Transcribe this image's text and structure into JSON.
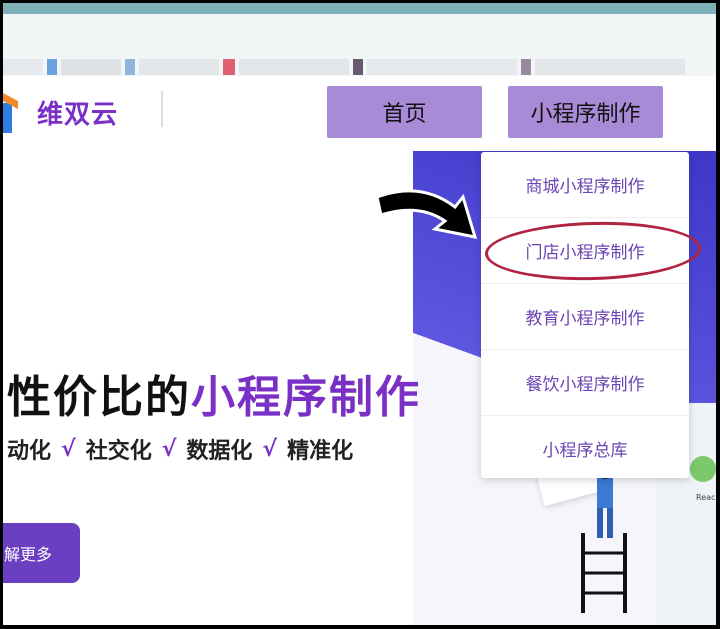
{
  "brand": {
    "name": "维双云"
  },
  "nav": {
    "home_label": "首页",
    "mini_program_label": "小程序制作"
  },
  "dropdown": {
    "items": [
      {
        "label": "商城小程序制作"
      },
      {
        "label": "门店小程序制作"
      },
      {
        "label": "教育小程序制作"
      },
      {
        "label": "餐饮小程序制作"
      },
      {
        "label": "小程序总库"
      }
    ],
    "highlighted_index": 1
  },
  "hero": {
    "headline_prefix": "性价比的",
    "headline_accent": "小程序制作",
    "taglines": [
      "动化",
      "社交化",
      "数据化",
      "精准化"
    ],
    "check_glyph": "√",
    "cta_label": "解更多",
    "illustration_label": "Reach"
  },
  "colors": {
    "brand": "#7a2fc7",
    "nav_button": "#a98ad6",
    "highlight": "#b0243f",
    "hero_blue": "#3d36c8"
  },
  "icons": [
    "logo-icon",
    "curved-arrow-icon",
    "checkmark-icon"
  ]
}
